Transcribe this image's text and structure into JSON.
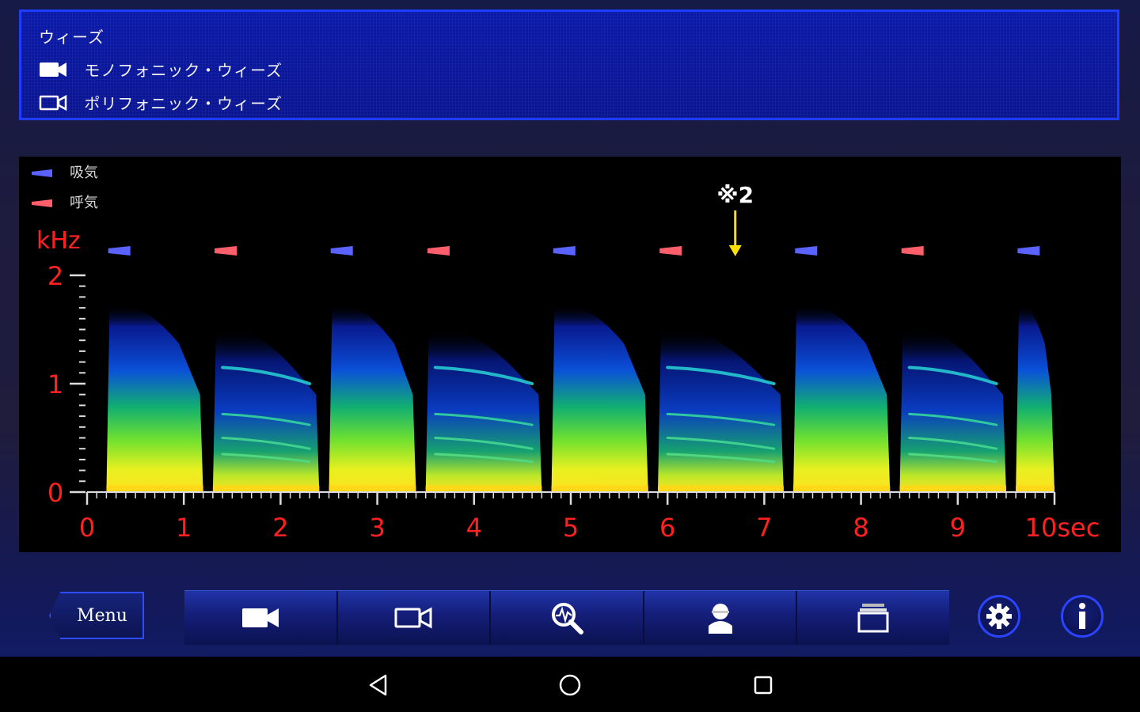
{
  "info_panel": {
    "title": "ウィーズ",
    "rows": [
      {
        "icon": "video-camera-filled-icon",
        "label": "モノフォニック・ウィーズ"
      },
      {
        "icon": "video-camera-outline-icon",
        "label": "ポリフォニック・ウィーズ"
      }
    ]
  },
  "spectrogram": {
    "legend": [
      {
        "label": "吸気",
        "color": "#5a62ff"
      },
      {
        "label": "呼気",
        "color": "#ff5f6a"
      }
    ],
    "y_unit": "kHz",
    "y_ticks": [
      "2",
      "1",
      "0"
    ],
    "x_ticks": [
      "0",
      "1",
      "2",
      "3",
      "4",
      "5",
      "6",
      "7",
      "8",
      "9",
      "10sec"
    ],
    "annotation": "※2",
    "annotation_time_sec": 6.7,
    "breath_markers": [
      {
        "phase": "inhale",
        "time_sec": 0.3
      },
      {
        "phase": "exhale",
        "time_sec": 1.4
      },
      {
        "phase": "inhale",
        "time_sec": 2.6
      },
      {
        "phase": "exhale",
        "time_sec": 3.6
      },
      {
        "phase": "inhale",
        "time_sec": 4.9
      },
      {
        "phase": "exhale",
        "time_sec": 6.0
      },
      {
        "phase": "inhale",
        "time_sec": 7.4
      },
      {
        "phase": "exhale",
        "time_sec": 8.5
      },
      {
        "phase": "inhale",
        "time_sec": 9.7
      }
    ],
    "colors": {
      "axis_label": "#ff2020",
      "annotation": "#ffe000",
      "axis_line": "#dddddd"
    }
  },
  "toolbar": {
    "menu_label": "Menu",
    "buttons": [
      {
        "icon": "video-camera-filled-icon"
      },
      {
        "icon": "video-camera-outline-icon"
      },
      {
        "icon": "zoom-waveform-icon"
      },
      {
        "icon": "person-icon"
      },
      {
        "icon": "window-icon"
      }
    ],
    "settings_icon": "gear-icon",
    "info_icon": "info-icon"
  },
  "navigation_bar": {
    "back_icon": "back-triangle-icon",
    "home_icon": "home-circle-icon",
    "recent_icon": "recent-square-icon"
  }
}
